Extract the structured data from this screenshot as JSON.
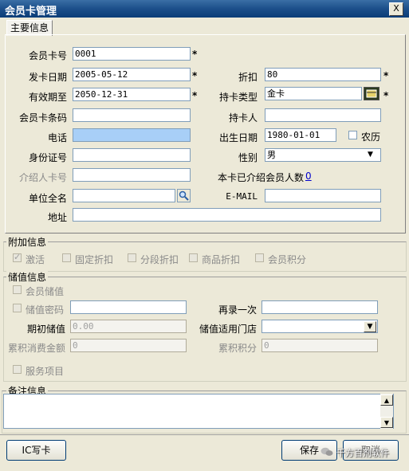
{
  "window": {
    "title": "会员卡管理",
    "close": "X"
  },
  "tab": "主要信息",
  "main": {
    "card_no_label": "会员卡号",
    "card_no": "0001",
    "issue_date_label": "发卡日期",
    "issue_date": "2005-05-12",
    "discount_label": "折扣",
    "discount": "80",
    "valid_until_label": "有效期至",
    "valid_until": "2050-12-31",
    "card_type_label": "持卡类型",
    "card_type": "金卡",
    "barcode_label": "会员卡条码",
    "barcode": "",
    "holder_label": "持卡人",
    "holder": "",
    "phone_label": "电话",
    "phone": "",
    "birth_label": "出生日期",
    "birth": "1980-01-01",
    "lunar_label": "农历",
    "id_label": "身份证号",
    "id": "",
    "gender_label": "性别",
    "gender": "男",
    "referrer_label": "介绍人卡号",
    "referrer": "",
    "referred_count_label": "本卡已介绍会员人数",
    "referred_count": "0",
    "company_label": "单位全名",
    "company": "",
    "email_label": "E-MAIL",
    "email": "",
    "address_label": "地址",
    "address": "",
    "required_mark": "*"
  },
  "extra": {
    "title": "附加信息",
    "items": [
      "激活",
      "固定折扣",
      "分段折扣",
      "商品折扣",
      "会员积分"
    ]
  },
  "stored": {
    "title": "储值信息",
    "stored_value_label": "会员储值",
    "password_label": "储值密码",
    "password": "",
    "repeat_label": "再录一次",
    "repeat": "",
    "initial_label": "期初储值",
    "initial": "0.00",
    "store_label": "储值适用门店",
    "store": "",
    "total_spent_label": "累积消费金额",
    "total_spent": "0",
    "points_label": "累积积分",
    "points": "0",
    "service_label": "服务项目"
  },
  "notes": {
    "title": "备注信息"
  },
  "buttons": {
    "ic": "IC写卡",
    "save": "保存",
    "cancel": "取消"
  },
  "watermark": "千方百剂软件"
}
